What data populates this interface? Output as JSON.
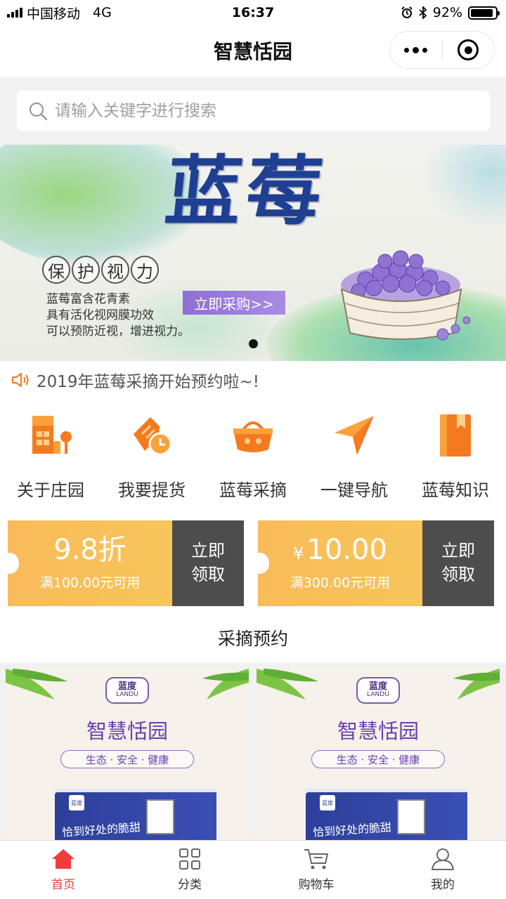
{
  "status_bar": {
    "carrier": "中国移动",
    "network": "4G",
    "time": "16:37",
    "battery": "92%",
    "battery_level": 0.92
  },
  "nav": {
    "title": "智慧恬园"
  },
  "search": {
    "placeholder": "请输入关键字进行搜索"
  },
  "banner": {
    "title": "蓝莓",
    "badge_chars": [
      "保",
      "护",
      "视",
      "力"
    ],
    "lines": [
      "蓝莓富含花青素",
      "具有活化视网膜功效",
      "可以预防近视，增进视力。"
    ],
    "button": "立即采购>>"
  },
  "notice": {
    "text": "2019年蓝莓采摘开始预约啦~!"
  },
  "menu": [
    {
      "label": "关于庄园",
      "icon": "building-icon"
    },
    {
      "label": "我要提货",
      "icon": "ticket-clock-icon"
    },
    {
      "label": "蓝莓采摘",
      "icon": "basket-icon"
    },
    {
      "label": "一键导航",
      "icon": "navigation-arrow-icon"
    },
    {
      "label": "蓝莓知识",
      "icon": "book-icon"
    }
  ],
  "coupons": [
    {
      "value": "9.8折",
      "currency": "",
      "condition": "满100.00元可用",
      "button": "立即\n领取"
    },
    {
      "value": "10.00",
      "currency": "¥",
      "condition": "满300.00元可用",
      "button": "立即\n领取"
    }
  ],
  "section": {
    "title": "采摘预约"
  },
  "products": [
    {
      "brand_cn": "蓝度",
      "brand_en": "LANDU",
      "title": "智慧恬园",
      "tag": "生态 · 安全 · 健康",
      "box_brand": "蓝度",
      "box_text": "恰到好处的脆甜"
    },
    {
      "brand_cn": "蓝度",
      "brand_en": "LANDU",
      "title": "智慧恬园",
      "tag": "生态 · 安全 · 健康",
      "box_brand": "蓝度",
      "box_text": "恰到好处的脆甜"
    }
  ],
  "tabs": [
    {
      "label": "首页",
      "icon": "home-icon",
      "active": true
    },
    {
      "label": "分类",
      "icon": "grid-icon",
      "active": false
    },
    {
      "label": "购物车",
      "icon": "cart-icon",
      "active": false
    },
    {
      "label": "我的",
      "icon": "user-icon",
      "active": false
    }
  ],
  "colors": {
    "accent": "#f23c3c",
    "coupon": "#f9bb5a",
    "coupon_button": "#4d4d4d",
    "icon_orange": "#f47a20"
  }
}
